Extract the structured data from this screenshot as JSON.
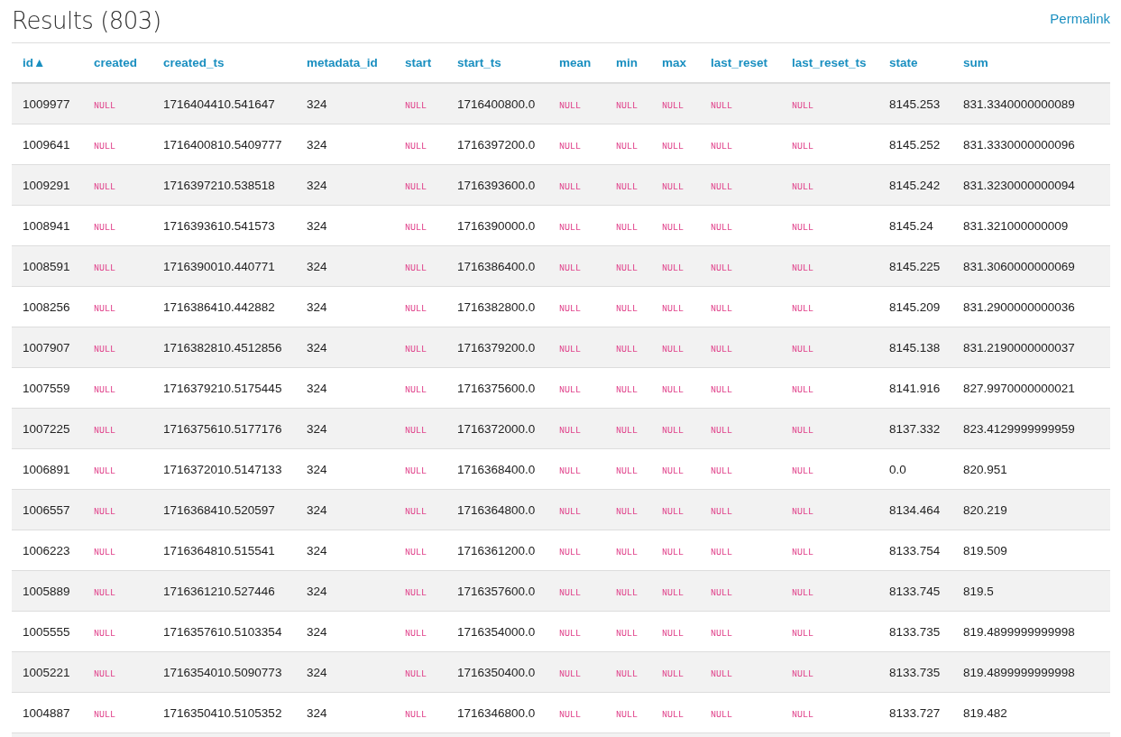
{
  "title": "Results (803)",
  "permalink": "Permalink",
  "table": {
    "columns": [
      "id▲",
      "created",
      "created_ts",
      "metadata_id",
      "start",
      "start_ts",
      "mean",
      "min",
      "max",
      "last_reset",
      "last_reset_ts",
      "state",
      "sum"
    ],
    "rows": [
      [
        {
          "kind": "value",
          "text": "1009977"
        },
        {
          "kind": "null",
          "text": "NULL"
        },
        {
          "kind": "value",
          "text": "1716404410.541647"
        },
        {
          "kind": "value",
          "text": "324"
        },
        {
          "kind": "null",
          "text": "NULL"
        },
        {
          "kind": "value",
          "text": "1716400800.0"
        },
        {
          "kind": "null",
          "text": "NULL"
        },
        {
          "kind": "null",
          "text": "NULL"
        },
        {
          "kind": "null",
          "text": "NULL"
        },
        {
          "kind": "null",
          "text": "NULL"
        },
        {
          "kind": "null",
          "text": "NULL"
        },
        {
          "kind": "value",
          "text": "8145.253"
        },
        {
          "kind": "value",
          "text": "831.3340000000089"
        }
      ],
      [
        {
          "kind": "value",
          "text": "1009641"
        },
        {
          "kind": "null",
          "text": "NULL"
        },
        {
          "kind": "value",
          "text": "1716400810.5409777"
        },
        {
          "kind": "value",
          "text": "324"
        },
        {
          "kind": "null",
          "text": "NULL"
        },
        {
          "kind": "value",
          "text": "1716397200.0"
        },
        {
          "kind": "null",
          "text": "NULL"
        },
        {
          "kind": "null",
          "text": "NULL"
        },
        {
          "kind": "null",
          "text": "NULL"
        },
        {
          "kind": "null",
          "text": "NULL"
        },
        {
          "kind": "null",
          "text": "NULL"
        },
        {
          "kind": "value",
          "text": "8145.252"
        },
        {
          "kind": "value",
          "text": "831.3330000000096"
        }
      ],
      [
        {
          "kind": "value",
          "text": "1009291"
        },
        {
          "kind": "null",
          "text": "NULL"
        },
        {
          "kind": "value",
          "text": "1716397210.538518"
        },
        {
          "kind": "value",
          "text": "324"
        },
        {
          "kind": "null",
          "text": "NULL"
        },
        {
          "kind": "value",
          "text": "1716393600.0"
        },
        {
          "kind": "null",
          "text": "NULL"
        },
        {
          "kind": "null",
          "text": "NULL"
        },
        {
          "kind": "null",
          "text": "NULL"
        },
        {
          "kind": "null",
          "text": "NULL"
        },
        {
          "kind": "null",
          "text": "NULL"
        },
        {
          "kind": "value",
          "text": "8145.242"
        },
        {
          "kind": "value",
          "text": "831.3230000000094"
        }
      ],
      [
        {
          "kind": "value",
          "text": "1008941"
        },
        {
          "kind": "null",
          "text": "NULL"
        },
        {
          "kind": "value",
          "text": "1716393610.541573"
        },
        {
          "kind": "value",
          "text": "324"
        },
        {
          "kind": "null",
          "text": "NULL"
        },
        {
          "kind": "value",
          "text": "1716390000.0"
        },
        {
          "kind": "null",
          "text": "NULL"
        },
        {
          "kind": "null",
          "text": "NULL"
        },
        {
          "kind": "null",
          "text": "NULL"
        },
        {
          "kind": "null",
          "text": "NULL"
        },
        {
          "kind": "null",
          "text": "NULL"
        },
        {
          "kind": "value",
          "text": "8145.24"
        },
        {
          "kind": "value",
          "text": "831.321000000009"
        }
      ],
      [
        {
          "kind": "value",
          "text": "1008591"
        },
        {
          "kind": "null",
          "text": "NULL"
        },
        {
          "kind": "value",
          "text": "1716390010.440771"
        },
        {
          "kind": "value",
          "text": "324"
        },
        {
          "kind": "null",
          "text": "NULL"
        },
        {
          "kind": "value",
          "text": "1716386400.0"
        },
        {
          "kind": "null",
          "text": "NULL"
        },
        {
          "kind": "null",
          "text": "NULL"
        },
        {
          "kind": "null",
          "text": "NULL"
        },
        {
          "kind": "null",
          "text": "NULL"
        },
        {
          "kind": "null",
          "text": "NULL"
        },
        {
          "kind": "value",
          "text": "8145.225"
        },
        {
          "kind": "value",
          "text": "831.3060000000069"
        }
      ],
      [
        {
          "kind": "value",
          "text": "1008256"
        },
        {
          "kind": "null",
          "text": "NULL"
        },
        {
          "kind": "value",
          "text": "1716386410.442882"
        },
        {
          "kind": "value",
          "text": "324"
        },
        {
          "kind": "null",
          "text": "NULL"
        },
        {
          "kind": "value",
          "text": "1716382800.0"
        },
        {
          "kind": "null",
          "text": "NULL"
        },
        {
          "kind": "null",
          "text": "NULL"
        },
        {
          "kind": "null",
          "text": "NULL"
        },
        {
          "kind": "null",
          "text": "NULL"
        },
        {
          "kind": "null",
          "text": "NULL"
        },
        {
          "kind": "value",
          "text": "8145.209"
        },
        {
          "kind": "value",
          "text": "831.2900000000036"
        }
      ],
      [
        {
          "kind": "value",
          "text": "1007907"
        },
        {
          "kind": "null",
          "text": "NULL"
        },
        {
          "kind": "value",
          "text": "1716382810.4512856"
        },
        {
          "kind": "value",
          "text": "324"
        },
        {
          "kind": "null",
          "text": "NULL"
        },
        {
          "kind": "value",
          "text": "1716379200.0"
        },
        {
          "kind": "null",
          "text": "NULL"
        },
        {
          "kind": "null",
          "text": "NULL"
        },
        {
          "kind": "null",
          "text": "NULL"
        },
        {
          "kind": "null",
          "text": "NULL"
        },
        {
          "kind": "null",
          "text": "NULL"
        },
        {
          "kind": "value",
          "text": "8145.138"
        },
        {
          "kind": "value",
          "text": "831.2190000000037"
        }
      ],
      [
        {
          "kind": "value",
          "text": "1007559"
        },
        {
          "kind": "null",
          "text": "NULL"
        },
        {
          "kind": "value",
          "text": "1716379210.5175445"
        },
        {
          "kind": "value",
          "text": "324"
        },
        {
          "kind": "null",
          "text": "NULL"
        },
        {
          "kind": "value",
          "text": "1716375600.0"
        },
        {
          "kind": "null",
          "text": "NULL"
        },
        {
          "kind": "null",
          "text": "NULL"
        },
        {
          "kind": "null",
          "text": "NULL"
        },
        {
          "kind": "null",
          "text": "NULL"
        },
        {
          "kind": "null",
          "text": "NULL"
        },
        {
          "kind": "value",
          "text": "8141.916"
        },
        {
          "kind": "value",
          "text": "827.9970000000021"
        }
      ],
      [
        {
          "kind": "value",
          "text": "1007225"
        },
        {
          "kind": "null",
          "text": "NULL"
        },
        {
          "kind": "value",
          "text": "1716375610.5177176"
        },
        {
          "kind": "value",
          "text": "324"
        },
        {
          "kind": "null",
          "text": "NULL"
        },
        {
          "kind": "value",
          "text": "1716372000.0"
        },
        {
          "kind": "null",
          "text": "NULL"
        },
        {
          "kind": "null",
          "text": "NULL"
        },
        {
          "kind": "null",
          "text": "NULL"
        },
        {
          "kind": "null",
          "text": "NULL"
        },
        {
          "kind": "null",
          "text": "NULL"
        },
        {
          "kind": "value",
          "text": "8137.332"
        },
        {
          "kind": "value",
          "text": "823.4129999999959"
        }
      ],
      [
        {
          "kind": "value",
          "text": "1006891"
        },
        {
          "kind": "null",
          "text": "NULL"
        },
        {
          "kind": "value",
          "text": "1716372010.5147133"
        },
        {
          "kind": "value",
          "text": "324"
        },
        {
          "kind": "null",
          "text": "NULL"
        },
        {
          "kind": "value",
          "text": "1716368400.0"
        },
        {
          "kind": "null",
          "text": "NULL"
        },
        {
          "kind": "null",
          "text": "NULL"
        },
        {
          "kind": "null",
          "text": "NULL"
        },
        {
          "kind": "null",
          "text": "NULL"
        },
        {
          "kind": "null",
          "text": "NULL"
        },
        {
          "kind": "value",
          "text": "0.0"
        },
        {
          "kind": "value",
          "text": "820.951"
        }
      ],
      [
        {
          "kind": "value",
          "text": "1006557"
        },
        {
          "kind": "null",
          "text": "NULL"
        },
        {
          "kind": "value",
          "text": "1716368410.520597"
        },
        {
          "kind": "value",
          "text": "324"
        },
        {
          "kind": "null",
          "text": "NULL"
        },
        {
          "kind": "value",
          "text": "1716364800.0"
        },
        {
          "kind": "null",
          "text": "NULL"
        },
        {
          "kind": "null",
          "text": "NULL"
        },
        {
          "kind": "null",
          "text": "NULL"
        },
        {
          "kind": "null",
          "text": "NULL"
        },
        {
          "kind": "null",
          "text": "NULL"
        },
        {
          "kind": "value",
          "text": "8134.464"
        },
        {
          "kind": "value",
          "text": "820.219"
        }
      ],
      [
        {
          "kind": "value",
          "text": "1006223"
        },
        {
          "kind": "null",
          "text": "NULL"
        },
        {
          "kind": "value",
          "text": "1716364810.515541"
        },
        {
          "kind": "value",
          "text": "324"
        },
        {
          "kind": "null",
          "text": "NULL"
        },
        {
          "kind": "value",
          "text": "1716361200.0"
        },
        {
          "kind": "null",
          "text": "NULL"
        },
        {
          "kind": "null",
          "text": "NULL"
        },
        {
          "kind": "null",
          "text": "NULL"
        },
        {
          "kind": "null",
          "text": "NULL"
        },
        {
          "kind": "null",
          "text": "NULL"
        },
        {
          "kind": "value",
          "text": "8133.754"
        },
        {
          "kind": "value",
          "text": "819.509"
        }
      ],
      [
        {
          "kind": "value",
          "text": "1005889"
        },
        {
          "kind": "null",
          "text": "NULL"
        },
        {
          "kind": "value",
          "text": "1716361210.527446"
        },
        {
          "kind": "value",
          "text": "324"
        },
        {
          "kind": "null",
          "text": "NULL"
        },
        {
          "kind": "value",
          "text": "1716357600.0"
        },
        {
          "kind": "null",
          "text": "NULL"
        },
        {
          "kind": "null",
          "text": "NULL"
        },
        {
          "kind": "null",
          "text": "NULL"
        },
        {
          "kind": "null",
          "text": "NULL"
        },
        {
          "kind": "null",
          "text": "NULL"
        },
        {
          "kind": "value",
          "text": "8133.745"
        },
        {
          "kind": "value",
          "text": "819.5"
        }
      ],
      [
        {
          "kind": "value",
          "text": "1005555"
        },
        {
          "kind": "null",
          "text": "NULL"
        },
        {
          "kind": "value",
          "text": "1716357610.5103354"
        },
        {
          "kind": "value",
          "text": "324"
        },
        {
          "kind": "null",
          "text": "NULL"
        },
        {
          "kind": "value",
          "text": "1716354000.0"
        },
        {
          "kind": "null",
          "text": "NULL"
        },
        {
          "kind": "null",
          "text": "NULL"
        },
        {
          "kind": "null",
          "text": "NULL"
        },
        {
          "kind": "null",
          "text": "NULL"
        },
        {
          "kind": "null",
          "text": "NULL"
        },
        {
          "kind": "value",
          "text": "8133.735"
        },
        {
          "kind": "value",
          "text": "819.4899999999998"
        }
      ],
      [
        {
          "kind": "value",
          "text": "1005221"
        },
        {
          "kind": "null",
          "text": "NULL"
        },
        {
          "kind": "value",
          "text": "1716354010.5090773"
        },
        {
          "kind": "value",
          "text": "324"
        },
        {
          "kind": "null",
          "text": "NULL"
        },
        {
          "kind": "value",
          "text": "1716350400.0"
        },
        {
          "kind": "null",
          "text": "NULL"
        },
        {
          "kind": "null",
          "text": "NULL"
        },
        {
          "kind": "null",
          "text": "NULL"
        },
        {
          "kind": "null",
          "text": "NULL"
        },
        {
          "kind": "null",
          "text": "NULL"
        },
        {
          "kind": "value",
          "text": "8133.735"
        },
        {
          "kind": "value",
          "text": "819.4899999999998"
        }
      ],
      [
        {
          "kind": "value",
          "text": "1004887"
        },
        {
          "kind": "null",
          "text": "NULL"
        },
        {
          "kind": "value",
          "text": "1716350410.5105352"
        },
        {
          "kind": "value",
          "text": "324"
        },
        {
          "kind": "null",
          "text": "NULL"
        },
        {
          "kind": "value",
          "text": "1716346800.0"
        },
        {
          "kind": "null",
          "text": "NULL"
        },
        {
          "kind": "null",
          "text": "NULL"
        },
        {
          "kind": "null",
          "text": "NULL"
        },
        {
          "kind": "null",
          "text": "NULL"
        },
        {
          "kind": "null",
          "text": "NULL"
        },
        {
          "kind": "value",
          "text": "8133.727"
        },
        {
          "kind": "value",
          "text": "819.482"
        }
      ]
    ]
  }
}
